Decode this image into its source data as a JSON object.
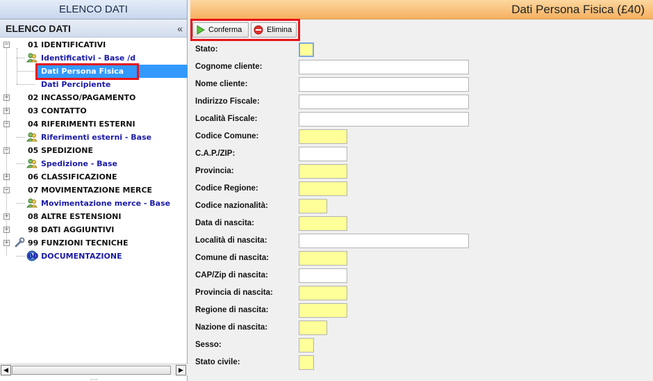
{
  "left_panel": {
    "header": "ELENCO DATI",
    "title": "ELENCO DATI",
    "collapse_glyph": "«",
    "tree": [
      {
        "label": "01 IDENTIFICATIVI",
        "kind": "top",
        "expander": "−",
        "icon": null
      },
      {
        "label": "Identificativi - Base /d",
        "kind": "sub",
        "expander": null,
        "icon": "users-icon"
      },
      {
        "label": "Dati Persona Fisica",
        "kind": "sel",
        "expander": null,
        "icon": null
      },
      {
        "label": "Dati Percipiente",
        "kind": "sub",
        "expander": null,
        "icon": null
      },
      {
        "label": "02 INCASSO/PAGAMENTO",
        "kind": "top",
        "expander": "+",
        "icon": null
      },
      {
        "label": "03 CONTATTO",
        "kind": "top",
        "expander": "+",
        "icon": null
      },
      {
        "label": "04 RIFERIMENTI ESTERNI",
        "kind": "top",
        "expander": "−",
        "icon": null
      },
      {
        "label": "Riferimenti esterni - Base",
        "kind": "sub",
        "expander": null,
        "icon": "users-icon"
      },
      {
        "label": "05 SPEDIZIONE",
        "kind": "top",
        "expander": "−",
        "icon": null
      },
      {
        "label": "Spedizione - Base",
        "kind": "sub",
        "expander": null,
        "icon": "users-icon"
      },
      {
        "label": "06 CLASSIFICAZIONE",
        "kind": "top",
        "expander": "+",
        "icon": null
      },
      {
        "label": "07 MOVIMENTAZIONE MERCE",
        "kind": "top",
        "expander": "−",
        "icon": null
      },
      {
        "label": "Movimentazione merce - Base",
        "kind": "sub",
        "expander": null,
        "icon": "users-icon"
      },
      {
        "label": "08 ALTRE ESTENSIONI",
        "kind": "top",
        "expander": "+",
        "icon": null
      },
      {
        "label": "98 DATI AGGIUNTIVI",
        "kind": "top",
        "expander": "+",
        "icon": null
      },
      {
        "label": "99 FUNZIONI TECNICHE",
        "kind": "top",
        "expander": "+",
        "icon": "wrench-icon"
      },
      {
        "label": "00 DOCUMENTAZIONE",
        "kind": "sub",
        "expander": null,
        "icon": "help-icon"
      }
    ]
  },
  "right_panel": {
    "header": "Dati Persona Fisica (£40)",
    "toolbar": {
      "confirm_label": "Conferma",
      "delete_label": "Elimina"
    },
    "fields": [
      {
        "label": "Stato:",
        "value": "",
        "color": "yellow",
        "size": "xs",
        "focused": true
      },
      {
        "label": "Cognome cliente:",
        "value": "",
        "color": "white",
        "size": "lg",
        "focused": false
      },
      {
        "label": "Nome cliente:",
        "value": "",
        "color": "white",
        "size": "lg",
        "focused": false
      },
      {
        "label": "Indirizzo Fiscale:",
        "value": "",
        "color": "white",
        "size": "lg",
        "focused": false
      },
      {
        "label": "Località Fiscale:",
        "value": "",
        "color": "white",
        "size": "lg",
        "focused": false
      },
      {
        "label": "Codice Comune:",
        "value": "",
        "color": "yellow",
        "size": "md",
        "focused": false
      },
      {
        "label": "C.A.P./ZIP:",
        "value": "",
        "color": "white",
        "size": "md",
        "focused": false
      },
      {
        "label": "Provincia:",
        "value": "",
        "color": "yellow",
        "size": "md",
        "focused": false
      },
      {
        "label": "Codice Regione:",
        "value": "",
        "color": "yellow",
        "size": "md",
        "focused": false
      },
      {
        "label": "Codice nazionalità:",
        "value": "",
        "color": "yellow",
        "size": "sm",
        "focused": false
      },
      {
        "label": "Data di nascita:",
        "value": "",
        "color": "yellow",
        "size": "md",
        "focused": false
      },
      {
        "label": "Località di nascita:",
        "value": "",
        "color": "white",
        "size": "lg",
        "focused": false
      },
      {
        "label": "Comune di nascita:",
        "value": "",
        "color": "yellow",
        "size": "md",
        "focused": false
      },
      {
        "label": "CAP/Zip di nascita:",
        "value": "",
        "color": "white",
        "size": "md",
        "focused": false
      },
      {
        "label": "Provincia di nascita:",
        "value": "",
        "color": "yellow",
        "size": "md",
        "focused": false
      },
      {
        "label": "Regione di nascita:",
        "value": "",
        "color": "yellow",
        "size": "md",
        "focused": false
      },
      {
        "label": "Nazione di nascita:",
        "value": "",
        "color": "yellow",
        "size": "sm",
        "focused": false
      },
      {
        "label": "Sesso:",
        "value": "",
        "color": "yellow",
        "size": "xs",
        "focused": false
      },
      {
        "label": "Stato civile:",
        "value": "",
        "color": "yellow",
        "size": "xs",
        "focused": false
      }
    ]
  },
  "colors": {
    "selection": "#3399ff",
    "highlight_box": "#e8131a",
    "required_field": "#ffff99",
    "header_orange": "#f6b060"
  }
}
